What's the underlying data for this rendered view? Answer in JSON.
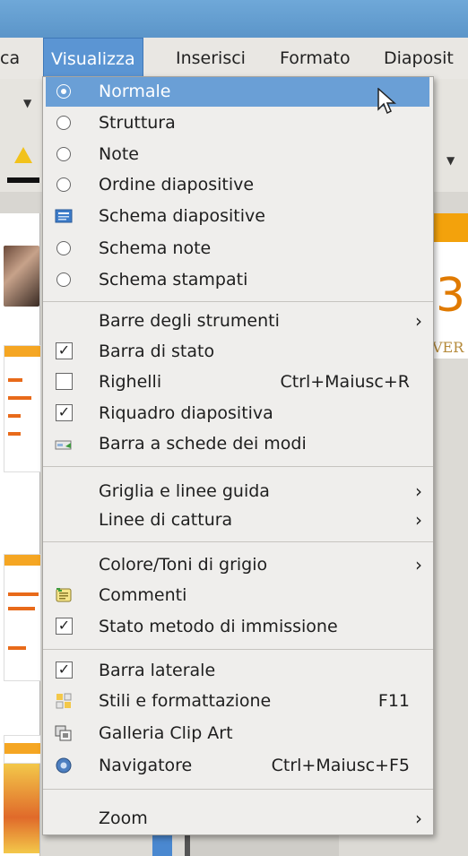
{
  "menubar": {
    "items": [
      "ca",
      "Visualizza",
      "Inserisci",
      "Formato",
      "Diaposit"
    ]
  },
  "background": {
    "slide_number": "3",
    "slide_text": "VER"
  },
  "menu": {
    "view_modes": [
      {
        "label": "Normale",
        "type": "radio",
        "selected": true
      },
      {
        "label": "Struttura",
        "type": "radio",
        "selected": false
      },
      {
        "label": "Note",
        "type": "radio",
        "selected": false
      },
      {
        "label": "Ordine diapositive",
        "type": "radio",
        "selected": false
      },
      {
        "label": "Schema diapositive",
        "type": "icon",
        "icon": "slide-master-icon"
      },
      {
        "label": "Schema note",
        "type": "radio",
        "selected": false
      },
      {
        "label": "Schema stampati",
        "type": "radio",
        "selected": false
      }
    ],
    "toolbars_label": "Barre degli strumenti",
    "statusbar_label": "Barra di stato",
    "rulers_label": "Righelli",
    "rulers_shortcut": "Ctrl+Maiusc+R",
    "slidepane_label": "Riquadro diapositiva",
    "tabbar_label": "Barra a schede dei modi",
    "grid_label": "Griglia e linee guida",
    "snap_label": "Linee di cattura",
    "color_label": "Colore/Toni di grigio",
    "comments_label": "Commenti",
    "ime_label": "Stato metodo di immissione",
    "sidebar_label": "Barra laterale",
    "styles_label": "Stili e formattazione",
    "styles_shortcut": "F11",
    "gallery_label": "Galleria Clip Art",
    "navigator_label": "Navigatore",
    "navigator_shortcut": "Ctrl+Maiusc+F5",
    "zoom_label": "Zoom",
    "submenu_arrow": "›",
    "check_mark": "✓"
  },
  "colors": {
    "highlight": "#6a9fd6",
    "menubar_active": "#5b95d3"
  }
}
